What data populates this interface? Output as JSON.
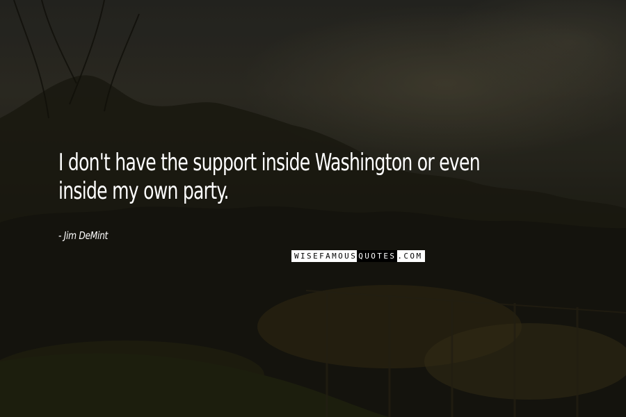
{
  "quote": {
    "text": "I don't have the support inside Washington or even inside my own party.",
    "author": "- Jim DeMint"
  },
  "watermark": {
    "part1": "WISEFAMOUS",
    "part2": "QUOTES",
    "part3": ".COM"
  },
  "colors": {
    "text": "#ffffff",
    "sky": "#2f2e27",
    "foliage": "#1b1a10"
  }
}
